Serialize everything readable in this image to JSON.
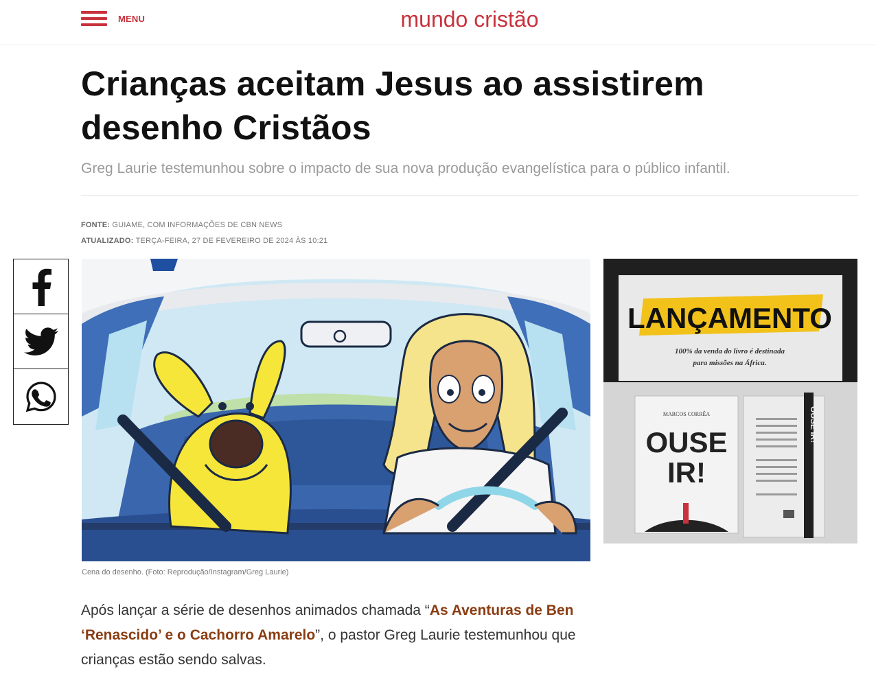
{
  "header": {
    "menu_label": "MENU",
    "brand": "mundo cristão"
  },
  "article": {
    "title": "Crianças aceitam Jesus ao assistirem desenho Cristãos",
    "subtitle": "Greg Laurie testemunhou sobre o impacto de sua nova produção evangelística para o público infantil.",
    "source_label": "FONTE:",
    "source_value": "GUIAME, COM INFORMAÇÕES DE CBN NEWS",
    "updated_label": "ATUALIZADO:",
    "updated_value": "TERÇA-FEIRA, 27 DE FEVEREIRO DE 2024 ÀS 10:21",
    "image_caption": "Cena do desenho. (Foto: Reprodução/Instagram/Greg Laurie)",
    "body_before": "Após lançar a série de desenhos animados chamada “",
    "body_link": "As Aventuras de Ben ‘Renascido’ e o Cachorro Amarelo",
    "body_after": "”, o pastor Greg Laurie testemunhou que crianças estão sendo salvas."
  },
  "share": {
    "buttons": [
      {
        "name": "facebook",
        "icon": "facebook-icon"
      },
      {
        "name": "twitter",
        "icon": "twitter-icon"
      },
      {
        "name": "whatsapp",
        "icon": "whatsapp-icon"
      }
    ]
  },
  "ad": {
    "headline": "LANÇAMENTO",
    "tagline_1": "100% da venda do livro é destinada",
    "tagline_2": "para missões na África.",
    "book_author": "MARCOS CORRÊA",
    "book_title_1": "OUSE",
    "book_title_2": "IR!",
    "spine_title": "OUSE IR!"
  },
  "colors": {
    "brand_red": "#c8323c",
    "link_brown": "#8a3d12",
    "ad_highlight": "#f2c21b"
  }
}
